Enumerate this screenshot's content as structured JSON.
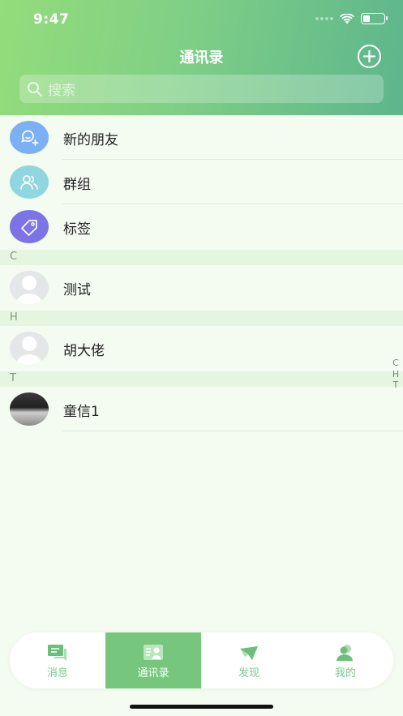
{
  "status_bar": {
    "time": "9:47"
  },
  "header": {
    "title": "通讯录"
  },
  "search": {
    "placeholder": "搜索"
  },
  "functions": [
    {
      "label": "新的朋友",
      "icon": "new-friend-icon",
      "color": "#7bb0f5"
    },
    {
      "label": "群组",
      "icon": "group-icon",
      "color": "#8fd6e0"
    },
    {
      "label": "标签",
      "icon": "tag-icon",
      "color": "#7b73e6"
    }
  ],
  "sections": [
    {
      "letter": "C",
      "contacts": [
        {
          "name": "测试"
        }
      ]
    },
    {
      "letter": "H",
      "contacts": [
        {
          "name": "胡大佬"
        }
      ]
    },
    {
      "letter": "T",
      "contacts": [
        {
          "name": "童信1"
        }
      ]
    }
  ],
  "index_letters": [
    "C",
    "H",
    "T"
  ],
  "tabbar": {
    "tabs": [
      {
        "label": "消息",
        "icon": "message-icon"
      },
      {
        "label": "通讯录",
        "icon": "contacts-icon",
        "active": true
      },
      {
        "label": "发现",
        "icon": "discover-icon"
      },
      {
        "label": "我的",
        "icon": "profile-icon"
      }
    ]
  },
  "colors": {
    "accent": "#76c67d",
    "header_start": "#94dd7b",
    "header_end": "#5db58c"
  }
}
